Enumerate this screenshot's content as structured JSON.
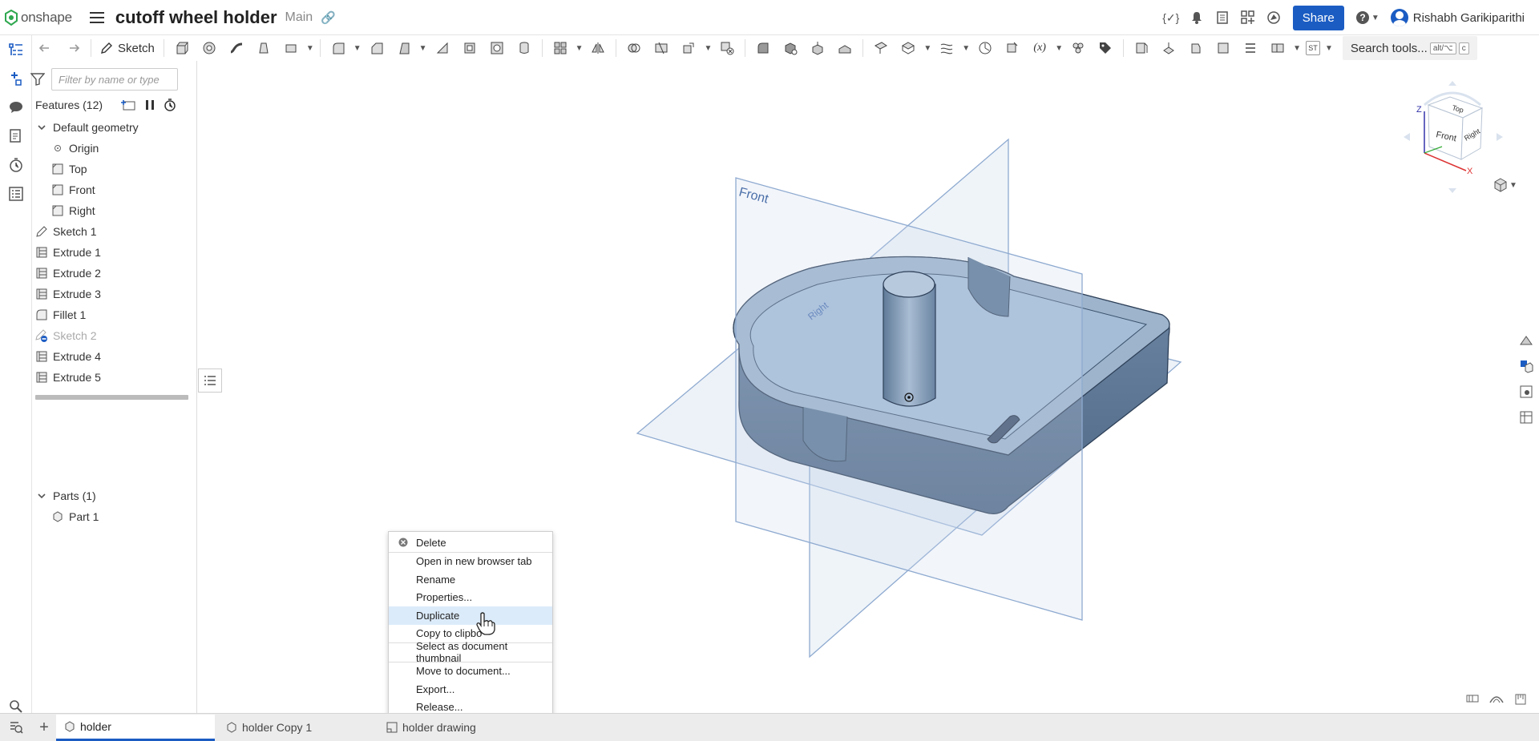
{
  "app": {
    "logo_text": "onshape",
    "doc_title": "cutoff wheel holder",
    "branch": "Main"
  },
  "header": {
    "share_label": "Share",
    "user_name": "Rishabh Garikiparithi",
    "help_label": "?"
  },
  "toolbar": {
    "sketch_label": "Sketch",
    "search_label": "Search tools...",
    "search_kbd1": "alt/⌥",
    "search_kbd2": "c",
    "st_label": "ST"
  },
  "filter": {
    "placeholder": "Filter by name or type"
  },
  "features": {
    "header": "Features (12)",
    "items": [
      {
        "label": "Default geometry",
        "icon": "chevron-down-icon"
      },
      {
        "label": "Origin",
        "icon": "origin-icon"
      },
      {
        "label": "Top",
        "icon": "plane-icon"
      },
      {
        "label": "Front",
        "icon": "plane-icon"
      },
      {
        "label": "Right",
        "icon": "plane-icon"
      },
      {
        "label": "Sketch 1",
        "icon": "sketch-icon"
      },
      {
        "label": "Extrude 1",
        "icon": "extrude-icon"
      },
      {
        "label": "Extrude 2",
        "icon": "extrude-icon"
      },
      {
        "label": "Extrude 3",
        "icon": "extrude-icon"
      },
      {
        "label": "Fillet 1",
        "icon": "fillet-icon"
      },
      {
        "label": "Sketch 2",
        "icon": "sketch-suppressed-icon"
      },
      {
        "label": "Extrude 4",
        "icon": "extrude-icon"
      },
      {
        "label": "Extrude 5",
        "icon": "extrude-icon"
      }
    ]
  },
  "parts": {
    "header": "Parts (1)",
    "items": [
      {
        "label": "Part 1"
      }
    ]
  },
  "viewcube": {
    "top": "Top",
    "front": "Front",
    "right": "Right",
    "axis_x": "X",
    "axis_z": "Z"
  },
  "viewport": {
    "plane_front": "Front",
    "plane_right": "Right"
  },
  "context_menu": {
    "items": [
      {
        "label": "Delete"
      },
      {
        "label": "Open in new browser tab"
      },
      {
        "label": "Rename"
      },
      {
        "label": "Properties..."
      },
      {
        "label": "Duplicate"
      },
      {
        "label": "Copy to clipbo"
      },
      {
        "label": "Select as document thumbnail"
      },
      {
        "label": "Move to document..."
      },
      {
        "label": "Export..."
      },
      {
        "label": "Release..."
      }
    ],
    "highlighted": "Duplicate"
  },
  "tabs": [
    {
      "label": "holder",
      "active": true
    },
    {
      "label": "holder Copy 1",
      "active": false
    },
    {
      "label": "holder drawing",
      "active": false
    }
  ],
  "colors": {
    "accent": "#1b5cc3",
    "highlight": "#dcebfa",
    "part": "#5c7896",
    "plane": "#b9cde6"
  }
}
